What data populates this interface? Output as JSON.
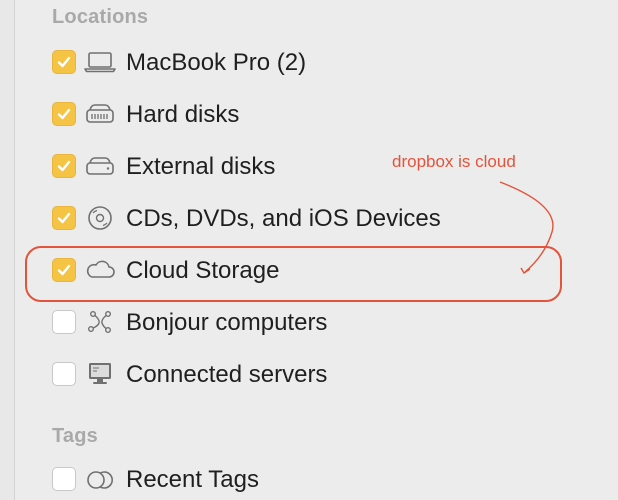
{
  "sections": {
    "locations_title": "Locations",
    "tags_title": "Tags"
  },
  "locations": [
    {
      "label": "MacBook Pro (2)",
      "checked": true,
      "icon": "laptop-icon"
    },
    {
      "label": "Hard disks",
      "checked": true,
      "icon": "hard-disk-icon"
    },
    {
      "label": "External disks",
      "checked": true,
      "icon": "external-disk-icon"
    },
    {
      "label": "CDs, DVDs, and iOS Devices",
      "checked": true,
      "icon": "disc-icon"
    },
    {
      "label": "Cloud Storage",
      "checked": true,
      "icon": "cloud-icon"
    },
    {
      "label": "Bonjour computers",
      "checked": false,
      "icon": "bonjour-icon"
    },
    {
      "label": "Connected servers",
      "checked": false,
      "icon": "server-monitor-icon"
    }
  ],
  "tags": [
    {
      "label": "Recent Tags",
      "checked": false,
      "icon": "tags-icon"
    }
  ],
  "annotation": {
    "text": "dropbox is cloud",
    "color": "#e4533b"
  },
  "colors": {
    "checkbox_checked": "#f5c445",
    "section_title": "#a9a9a9"
  }
}
